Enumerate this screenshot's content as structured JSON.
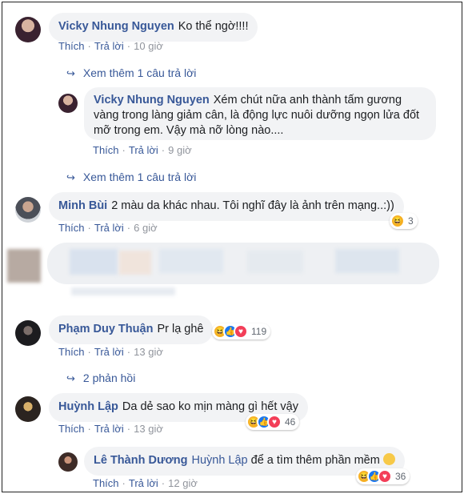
{
  "comments": [
    {
      "name": "Vicky Nhung Nguyen",
      "text": "Ko thể ngờ!!!!",
      "like": "Thích",
      "reply": "Trả lời",
      "time": "10 giờ"
    },
    {
      "more": "Xem thêm 1 câu trả lời"
    },
    {
      "name": "Vicky Nhung Nguyen",
      "text": "Xém chút nữa anh thành tấm gương vàng trong làng giảm cân, là động lực nuôi dưỡng ngọn lửa đốt mỡ trong em. Vậy mà nỡ lòng nào....",
      "like": "Thích",
      "reply": "Trả lời",
      "time": "9 giờ"
    },
    {
      "more": "Xem thêm 1 câu trả lời"
    },
    {
      "name": "Minh Bùi",
      "text": "2 màu da khác nhau. Tôi nghĩ đây là ảnh trên mạng..:))",
      "like": "Thích",
      "reply": "Trả lời",
      "time": "6 giờ",
      "reaction_count": "3"
    },
    {
      "name": "Phạm Duy Thuận",
      "text": "Pr lạ ghê",
      "like": "Thích",
      "reply": "Trả lời",
      "time": "13 giờ",
      "reaction_count": "119"
    },
    {
      "more": "2 phản hồi"
    },
    {
      "name": "Huỳnh Lập",
      "text": "Da dẻ sao ko mịn màng gì hết vậy",
      "like": "Thích",
      "reply": "Trả lời",
      "time": "13 giờ",
      "reaction_count": "46"
    },
    {
      "name": "Lê Thành Dương",
      "mention": "Huỳnh Lập",
      "text": "để a tìm thêm phần mềm",
      "like": "Thích",
      "reply": "Trả lời",
      "time": "12 giờ",
      "reaction_count": "36"
    }
  ],
  "colors": {
    "link": "#385898",
    "bubble": "#f2f3f5",
    "meta": "#90949c"
  },
  "icons": {
    "reply_arrow": "reply-arrow-icon",
    "haha": "haha-icon",
    "like": "like-icon",
    "love": "love-icon",
    "emoji": "slightly-frowning-emoji"
  }
}
